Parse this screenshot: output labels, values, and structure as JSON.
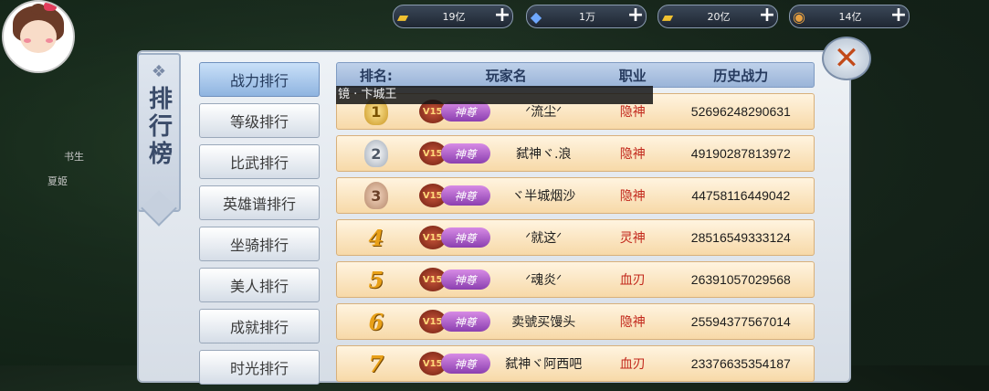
{
  "side_names": [
    "书生",
    "夏姬"
  ],
  "resources": [
    {
      "icon": "gold-ingot-lock-icon",
      "value": "19亿"
    },
    {
      "icon": "diamond-icon",
      "value": "1万"
    },
    {
      "icon": "gold-ingot-icon",
      "value": "20亿"
    },
    {
      "icon": "coin-icon",
      "value": "14亿"
    }
  ],
  "panel": {
    "title": "排行榜"
  },
  "tooltip": "镜 · 卞城王",
  "tabs": [
    "战力排行",
    "等级排行",
    "比武排行",
    "英雄谱排行",
    "坐骑排行",
    "美人排行",
    "成就排行",
    "时光排行"
  ],
  "table": {
    "headers": [
      "排名:",
      "玩家名",
      "职业",
      "历史战力"
    ],
    "rows": [
      {
        "rank": "1",
        "vip": "V15",
        "title": "神尊",
        "name": "ᐟ流尘ᐟ",
        "job": "隐神",
        "power": "52696248290631"
      },
      {
        "rank": "2",
        "vip": "V15",
        "title": "神尊",
        "name": "弑神ヾ.浪",
        "job": "隐神",
        "power": "49190287813972"
      },
      {
        "rank": "3",
        "vip": "V15",
        "title": "神尊",
        "name": "ヾ半城烟沙",
        "job": "隐神",
        "power": "44758116449042"
      },
      {
        "rank": "4",
        "vip": "V15",
        "title": "神尊",
        "name": "ᐟ就这ᐟ",
        "job": "灵神",
        "power": "28516549333124"
      },
      {
        "rank": "5",
        "vip": "V15",
        "title": "神尊",
        "name": "ᐟ魂炎ᐟ",
        "job": "血刃",
        "power": "26391057029568"
      },
      {
        "rank": "6",
        "vip": "V15",
        "title": "神尊",
        "name": "卖號买馒头",
        "job": "隐神",
        "power": "25594377567014"
      },
      {
        "rank": "7",
        "vip": "V15",
        "title": "神尊",
        "name": "弑神ヾ阿西吧",
        "job": "血刃",
        "power": "23376635354187"
      }
    ]
  },
  "colors": {
    "job_text": "#c2271b",
    "active_tab": "#8fb4e0",
    "row_bg": "#f7d9a8"
  }
}
